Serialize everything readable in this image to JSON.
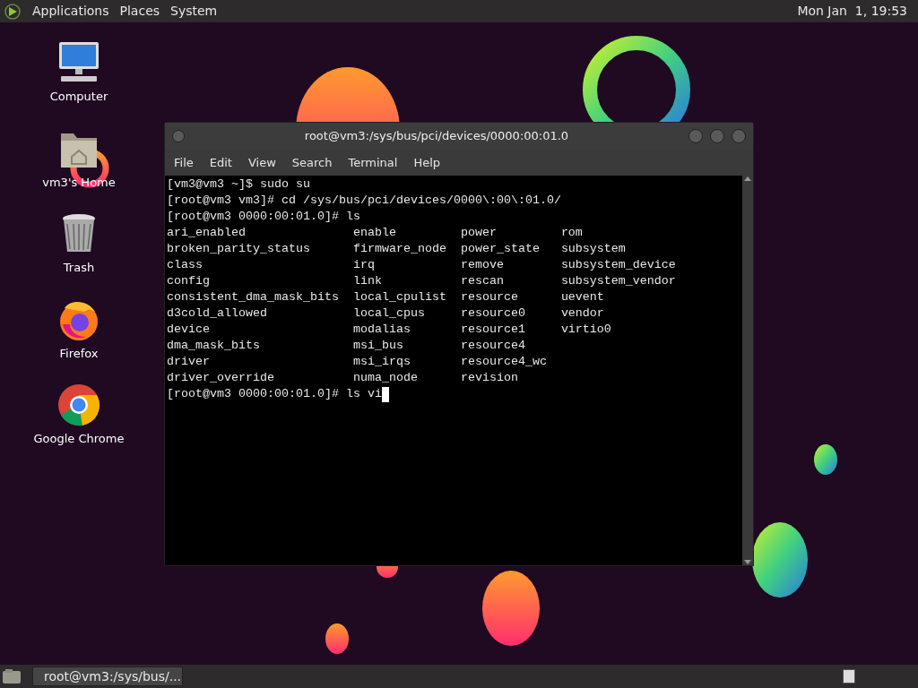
{
  "top_panel": {
    "menus": [
      "Applications",
      "Places",
      "System"
    ],
    "clock": "Mon Jan  1, 19:53"
  },
  "desktop_icons": [
    {
      "kind": "computer",
      "label": "Computer"
    },
    {
      "kind": "home",
      "label": "vm3's Home"
    },
    {
      "kind": "trash",
      "label": "Trash"
    },
    {
      "kind": "firefox",
      "label": "Firefox"
    },
    {
      "kind": "chrome",
      "label": "Google Chrome"
    }
  ],
  "terminal": {
    "title": "root@vm3:/sys/bus/pci/devices/0000:00:01.0",
    "menu": [
      "File",
      "Edit",
      "View",
      "Search",
      "Terminal",
      "Help"
    ],
    "lines_before": [
      "[vm3@vm3 ~]$ sudo su",
      "[root@vm3 vm3]# cd /sys/bus/pci/devices/0000\\:00\\:01.0/",
      "[root@vm3 0000:00:01.0]# ls"
    ],
    "listing": [
      [
        "ari_enabled",
        "enable",
        "power",
        "rom"
      ],
      [
        "broken_parity_status",
        "firmware_node",
        "power_state",
        "subsystem"
      ],
      [
        "class",
        "irq",
        "remove",
        "subsystem_device"
      ],
      [
        "config",
        "link",
        "rescan",
        "subsystem_vendor"
      ],
      [
        "consistent_dma_mask_bits",
        "local_cpulist",
        "resource",
        "uevent"
      ],
      [
        "d3cold_allowed",
        "local_cpus",
        "resource0",
        "vendor"
      ],
      [
        "device",
        "modalias",
        "resource1",
        "virtio0"
      ],
      [
        "dma_mask_bits",
        "msi_bus",
        "resource4"
      ],
      [
        "driver",
        "msi_irqs",
        "resource4_wc"
      ],
      [
        "driver_override",
        "numa_node",
        "revision"
      ]
    ],
    "command_line": "[root@vm3 0000:00:01.0]# ls vi"
  },
  "taskbar": {
    "tasks": [
      "root@vm3:/sys/bus/..."
    ]
  }
}
